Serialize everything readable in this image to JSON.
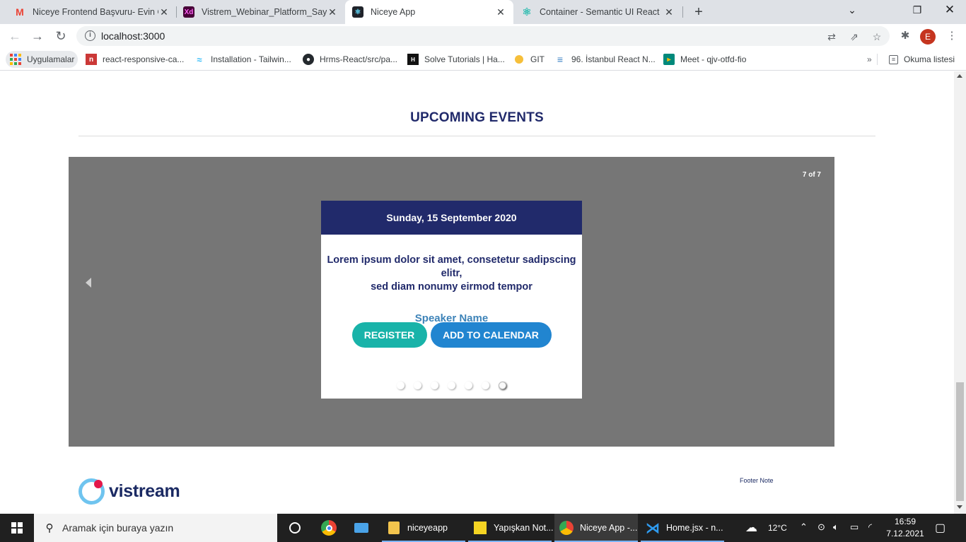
{
  "browser": {
    "tabs": [
      {
        "title": "Niceye Frontend Başvuru- Evin Ö",
        "icon": "gmail-icon"
      },
      {
        "title": "Vistrem_Webinar_Platform_Sayfa",
        "icon": "adobe-xd-icon"
      },
      {
        "title": "Niceye App",
        "icon": "react-icon",
        "active": true
      },
      {
        "title": "Container - Semantic UI React",
        "icon": "react-icon"
      }
    ],
    "url": "localhost:3000",
    "profile_initial": "E",
    "bookmarks": [
      {
        "label": "Uygulamalar"
      },
      {
        "label": "react-responsive-ca..."
      },
      {
        "label": "Installation - Tailwin..."
      },
      {
        "label": "Hrms-React/src/pa..."
      },
      {
        "label": "Solve Tutorials | Ha..."
      },
      {
        "label": "GIT"
      },
      {
        "label": "96. İstanbul React N..."
      },
      {
        "label": "Meet - qjv-otfd-fio"
      }
    ],
    "reading_list": "Okuma listesi"
  },
  "page": {
    "section_title": "UPCOMING EVENTS",
    "carousel": {
      "counter": "7 of 7",
      "total_slides": 7,
      "active_slide": 7,
      "card": {
        "date": "Sunday, 15 September 2020",
        "description_line1": "Lorem ipsum dolor sit amet, consetetur sadipscing elitr,",
        "description_line2": "sed diam nonumy eirmod tempor",
        "speaker": "Speaker Name",
        "register_label": "REGISTER",
        "calendar_label": "ADD TO CALENDAR"
      }
    },
    "footer": {
      "logo_text": "vistream",
      "note": "Footer Note"
    },
    "colors": {
      "navy": "#212a6b",
      "carousel_bg": "#767676",
      "register": "#19b3a9",
      "calendar": "#2185d0",
      "speaker": "#3d83b8"
    }
  },
  "taskbar": {
    "search_placeholder": "Aramak için buraya yazın",
    "apps": [
      {
        "label": "niceyeapp"
      },
      {
        "label": "Yapışkan Not..."
      },
      {
        "label": "Niceye App -..."
      },
      {
        "label": "Home.jsx - n..."
      }
    ],
    "weather": "12°C",
    "time": "16:59",
    "date": "7.12.2021"
  }
}
